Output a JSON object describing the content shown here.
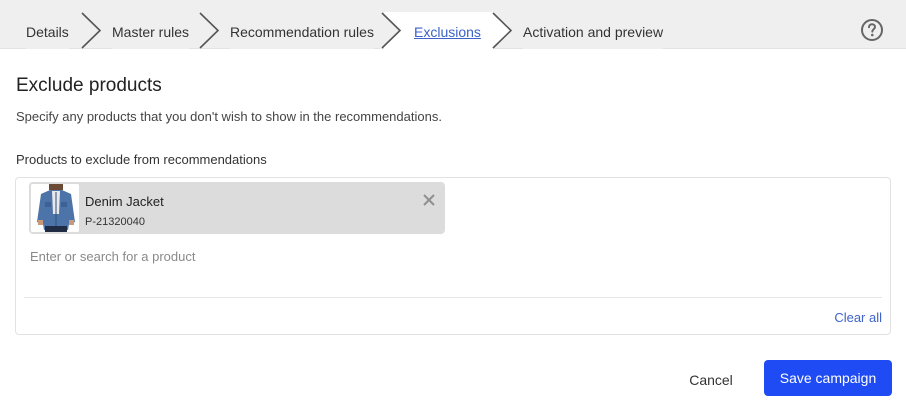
{
  "stepper": {
    "steps": [
      {
        "label": "Details",
        "active": false
      },
      {
        "label": "Master rules",
        "active": false
      },
      {
        "label": "Recommendation rules",
        "active": false
      },
      {
        "label": "Exclusions",
        "active": true
      },
      {
        "label": "Activation and preview",
        "active": false
      }
    ],
    "help_icon": "question-circle-icon"
  },
  "main": {
    "title": "Exclude products",
    "subtitle": "Specify any products that you don't wish to show in the recommendations.",
    "field_label": "Products to exclude from recommendations"
  },
  "picker": {
    "selected": [
      {
        "name": "Denim Jacket",
        "sku": "P-21320040",
        "thumbnail": "denim-jacket-thumbnail",
        "remove_icon": "close-icon"
      }
    ],
    "search_placeholder": "Enter or search for a product",
    "search_value": "",
    "clear_all_label": "Clear all"
  },
  "footer": {
    "cancel_label": "Cancel",
    "save_label": "Save campaign"
  },
  "colors": {
    "accent": "#1f4bf5",
    "link": "#3d63c9",
    "stepper_bg": "#efefef",
    "chip_bg": "#dcdcdc"
  }
}
